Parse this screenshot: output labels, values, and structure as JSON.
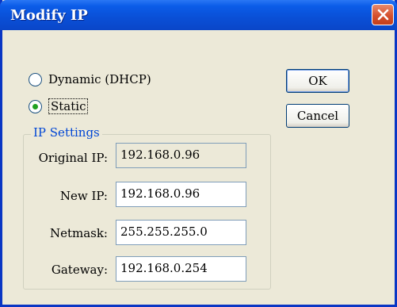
{
  "window": {
    "title": "Modify IP"
  },
  "mode": {
    "options": [
      {
        "label": "Dynamic (DHCP)",
        "selected": false
      },
      {
        "label": "Static",
        "selected": true
      }
    ]
  },
  "buttons": {
    "ok": "OK",
    "cancel": "Cancel"
  },
  "ip_settings": {
    "legend": "IP Settings",
    "original_ip": {
      "label": "Original IP:",
      "value": "192.168.0.96"
    },
    "new_ip": {
      "label": "New IP:",
      "value": "192.168.0.96"
    },
    "netmask": {
      "label": "Netmask:",
      "value": "255.255.255.0"
    },
    "gateway": {
      "label": "Gateway:",
      "value": "192.168.0.254"
    }
  }
}
